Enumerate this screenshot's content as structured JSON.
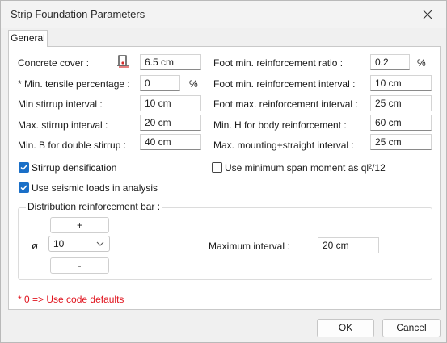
{
  "window": {
    "title": "Strip Foundation Parameters"
  },
  "tabs": [
    {
      "label": "General"
    }
  ],
  "left": {
    "concrete_cover": {
      "label": "Concrete cover :",
      "value": "6.5 cm"
    },
    "min_tensile": {
      "label": "* Min. tensile percentage :",
      "value": "0",
      "unit": "%"
    },
    "min_stirrup": {
      "label": "Min stirrup interval :",
      "value": "10 cm"
    },
    "max_stirrup": {
      "label": "Max. stirrup interval :",
      "value": "20 cm"
    },
    "min_b_double": {
      "label": "Min. B for double stirrup :",
      "value": "40 cm"
    }
  },
  "right": {
    "foot_min_ratio": {
      "label": "Foot min. reinforcement ratio :",
      "value": "0.2",
      "unit": "%"
    },
    "foot_min_interval": {
      "label": "Foot min. reinforcement interval :",
      "value": "10 cm"
    },
    "foot_max_interval": {
      "label": "Foot max. reinforcement interval :",
      "value": "25 cm"
    },
    "min_h_body": {
      "label": "Min. H for body reinforcement :",
      "value": "60 cm"
    },
    "max_mounting": {
      "label": "Max. mounting+straight interval :",
      "value": "25 cm"
    }
  },
  "checkboxes": {
    "stirrup_densification": {
      "label": "Stirrup densification",
      "checked": true
    },
    "use_min_span": {
      "label": "Use minimum span moment as ql²/12",
      "checked": false
    },
    "use_seismic": {
      "label": "Use seismic loads in analysis",
      "checked": true
    }
  },
  "distribution": {
    "title": "Distribution reinforcement bar :",
    "plus_label": "+",
    "minus_label": "-",
    "diameter_symbol": "ø",
    "diameter_value": "10",
    "max_interval_label": "Maximum interval :",
    "max_interval_value": "20 cm"
  },
  "note": "* 0 => Use code defaults",
  "buttons": {
    "ok": "OK",
    "cancel": "Cancel"
  },
  "colors": {
    "accent": "#1a6fc7",
    "note": "#e0141e"
  },
  "icons": [
    "close-icon",
    "section-icon",
    "chevron-down-icon",
    "checkmark-icon"
  ]
}
